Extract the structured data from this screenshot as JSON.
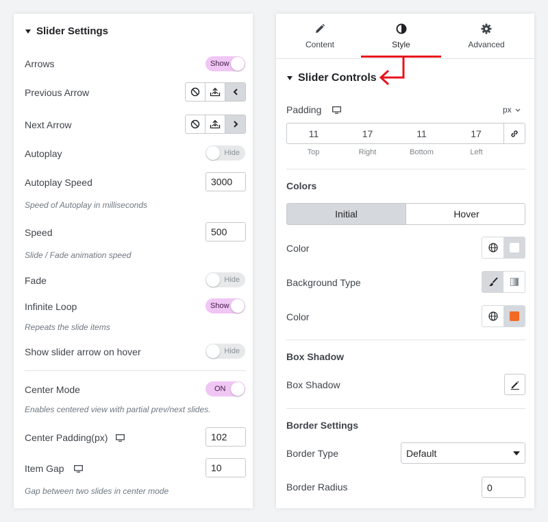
{
  "left": {
    "section_title": "Slider Settings",
    "arrows": {
      "label": "Arrows",
      "toggle": "Show"
    },
    "previous_arrow": {
      "label": "Previous Arrow"
    },
    "next_arrow": {
      "label": "Next Arrow"
    },
    "autoplay": {
      "label": "Autoplay",
      "toggle": "Hide"
    },
    "autoplay_speed": {
      "label": "Autoplay Speed",
      "value": "3000",
      "description": "Speed of Autoplay in milliseconds"
    },
    "speed": {
      "label": "Speed",
      "value": "500",
      "description": "Slide / Fade animation speed"
    },
    "fade": {
      "label": "Fade",
      "toggle": "Hide"
    },
    "infinite_loop": {
      "label": "Infinite Loop",
      "toggle": "Show",
      "description": "Repeats the slide items"
    },
    "show_arrow_hover": {
      "label": "Show slider arrow on hover",
      "toggle": "Hide"
    },
    "center_mode": {
      "label": "Center Mode",
      "toggle": "ON",
      "description": "Enables centered view with partial prev/next slides."
    },
    "center_padding": {
      "label": "Center Padding(px)",
      "value": "102"
    },
    "item_gap": {
      "label": "Item Gap",
      "value": "10",
      "description": "Gap between two slides in center mode"
    }
  },
  "right": {
    "tabs": [
      {
        "label": "Content",
        "icon": "pencil-icon"
      },
      {
        "label": "Style",
        "icon": "half-circle-icon"
      },
      {
        "label": "Advanced",
        "icon": "gear-icon"
      }
    ],
    "section_title": "Slider Controls",
    "padding": {
      "label": "Padding",
      "unit": "px",
      "values": [
        "11",
        "17",
        "11",
        "17"
      ],
      "captions": [
        "Top",
        "Right",
        "Bottom",
        "Left"
      ]
    },
    "colors": {
      "heading": "Colors",
      "state_tabs": [
        "Initial",
        "Hover"
      ],
      "color_label": "Color",
      "background_type_label": "Background Type",
      "color2_label": "Color"
    },
    "box_shadow": {
      "heading": "Box Shadow",
      "label": "Box Shadow"
    },
    "border": {
      "heading": "Border Settings",
      "type_label": "Border Type",
      "type_value": "Default",
      "radius_label": "Border Radius",
      "radius_value": "0"
    }
  },
  "colors": {
    "toggle_on": "#f0c6f4",
    "toggle_off": "#e6e8ea",
    "annotation_red": "#e8131b",
    "swatch_orange": "#f26a26"
  }
}
